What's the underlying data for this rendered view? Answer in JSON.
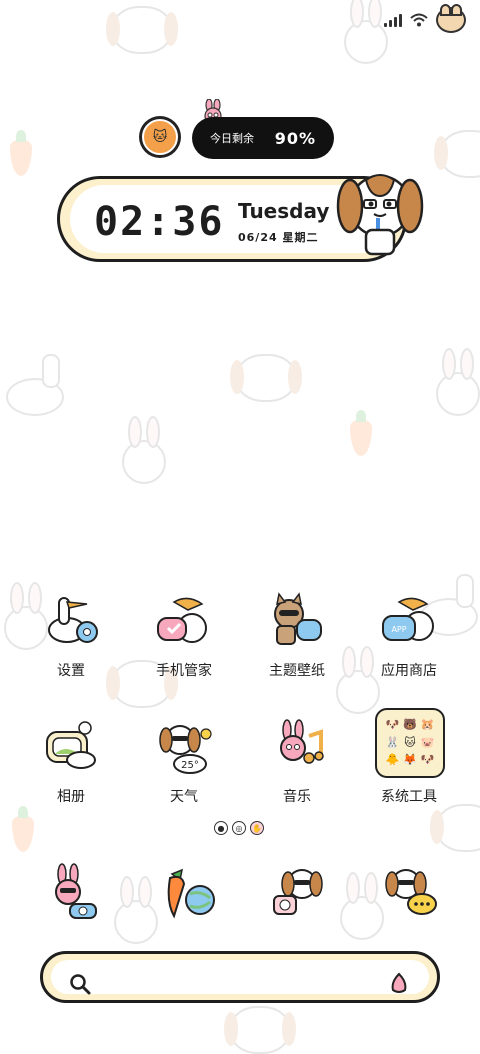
{
  "status_bar": {
    "signal_icon": "signal-icon",
    "wifi_icon": "wifi-icon",
    "battery_icon": "pet-battery-icon"
  },
  "battery_widget": {
    "label": "今日剩余",
    "value": "90%",
    "level": 0.9
  },
  "clock_widget": {
    "time": "02:36",
    "day": "Tuesday",
    "date": "06/24  星期二"
  },
  "apps": [
    {
      "name": "设置",
      "icon": "goose-settings-icon"
    },
    {
      "name": "手机管家",
      "icon": "pelican-phone-manager-icon"
    },
    {
      "name": "主题壁纸",
      "icon": "cat-theme-icon"
    },
    {
      "name": "应用商店",
      "icon": "pelican-app-store-icon"
    },
    {
      "name": "相册",
      "icon": "goose-gallery-icon"
    },
    {
      "name": "天气",
      "icon": "dog-weather-icon",
      "temp": "25°"
    },
    {
      "name": "音乐",
      "icon": "bunny-music-icon"
    },
    {
      "name": "系统工具",
      "icon": "folder-icon"
    }
  ],
  "dock": [
    {
      "icon": "bunny-phone-icon"
    },
    {
      "icon": "carrot-browser-icon"
    },
    {
      "icon": "dog-camera-icon"
    },
    {
      "icon": "dog-messages-icon"
    }
  ],
  "search": {
    "icon": "search-icon",
    "mic_icon": "voice-icon"
  },
  "colors": {
    "accent_cream": "#fdf0cc",
    "outline": "#1e1e1e",
    "pill_bg": "#111111"
  }
}
